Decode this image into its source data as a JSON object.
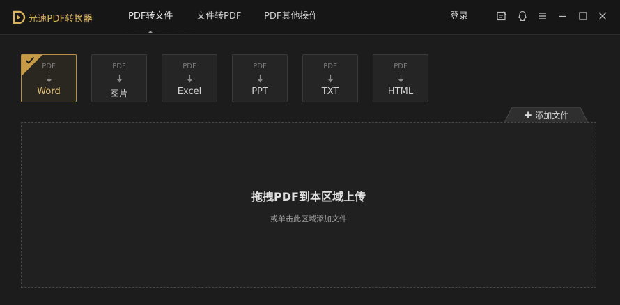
{
  "app": {
    "name": "光速PDF转换器",
    "brand_color": "#d9b25e"
  },
  "nav": {
    "tabs": [
      {
        "label": "PDF转文件",
        "active": true
      },
      {
        "label": "文件转PDF",
        "active": false
      },
      {
        "label": "PDF其他操作",
        "active": false
      }
    ],
    "login_label": "登录"
  },
  "window_controls": [
    "edit-icon",
    "qq-icon",
    "menu-icon",
    "minimize-icon",
    "maximize-icon",
    "close-icon"
  ],
  "formats": [
    {
      "source": "PDF",
      "target": "Word",
      "selected": true
    },
    {
      "source": "PDF",
      "target": "图片",
      "selected": false
    },
    {
      "source": "PDF",
      "target": "Excel",
      "selected": false
    },
    {
      "source": "PDF",
      "target": "PPT",
      "selected": false
    },
    {
      "source": "PDF",
      "target": "TXT",
      "selected": false
    },
    {
      "source": "PDF",
      "target": "HTML",
      "selected": false
    }
  ],
  "add_file_label": "添加文件",
  "dropzone": {
    "title": "拖拽PDF到本区域上传",
    "subtitle": "或单击此区域添加文件"
  }
}
